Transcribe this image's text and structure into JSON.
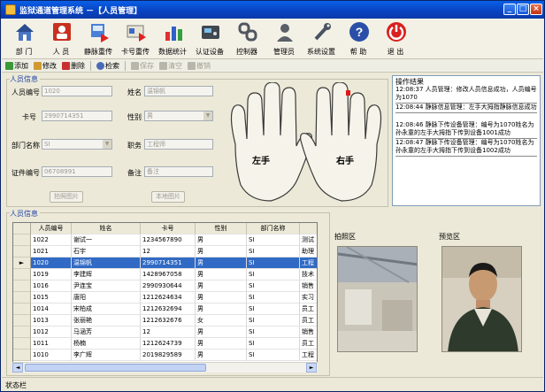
{
  "window": {
    "title": "监狱通道管理系统 －【人员管理】",
    "controls": {
      "minimize": "_",
      "restore": "□",
      "close": "×"
    }
  },
  "toolbar": [
    {
      "label": "部 门",
      "icon": "house-icon"
    },
    {
      "label": "人 员",
      "icon": "person-card-icon"
    },
    {
      "label": "静脉重传",
      "icon": "vein-upload-icon"
    },
    {
      "label": "卡号重传",
      "icon": "card-upload-icon"
    },
    {
      "label": "数据统计",
      "icon": "bar-chart-icon"
    },
    {
      "label": "认证设备",
      "icon": "device-icon"
    },
    {
      "label": "控制器",
      "icon": "chain-icon"
    },
    {
      "label": "管理员",
      "icon": "admin-icon"
    },
    {
      "label": "系统设置",
      "icon": "wrench-icon"
    },
    {
      "label": "帮 助",
      "icon": "help-icon"
    },
    {
      "label": "退 出",
      "icon": "power-icon"
    }
  ],
  "commands": {
    "add": "添加",
    "edit": "修改",
    "delete": "删除",
    "search": "检索",
    "save": "保存",
    "clear": "清空",
    "undo": "撤销"
  },
  "form": {
    "section_title": "人员信息",
    "id_label": "人员编号",
    "id_value": "1020",
    "name_label": "姓名",
    "name_value": "温锦帆",
    "card_label": "卡号",
    "card_value": "2990714351",
    "gender_label": "性别",
    "gender_value": "男",
    "dept_label": "部门名称",
    "dept_value": "SI",
    "job_label": "职务",
    "job_value": "工程师",
    "cert_label": "证件编号",
    "cert_value": "06708991",
    "note_label": "备注",
    "note_value": "备注",
    "capture_button": "拍照图片",
    "local_button": "本地图片"
  },
  "hands": {
    "left": "左手",
    "right": "右手"
  },
  "log": {
    "title": "操作结果",
    "entries": [
      "12:08:37  人员管理：修改人员信息成功，人员编号为1070",
      "12:08:44  静脉信息管理：左手大拇指静脉信息成功",
      "12:08:46  静脉下传设备管理：编号为1070姓名为孙永童的左手大拇指下传到设备1001成功",
      "12:08:47  静脉下传设备管理：编号为1070姓名为孙永童的左手大拇指下传到设备1002成功"
    ]
  },
  "grid": {
    "section_title": "人员信息",
    "columns": [
      "人员编号",
      "姓名",
      "卡号",
      "性别",
      "部门名称",
      ""
    ],
    "rows": [
      [
        "1022",
        "谢试一",
        "1234567890",
        "男",
        "SI",
        "测试"
      ],
      [
        "1021",
        "石宇",
        "12",
        "男",
        "SI",
        "助理"
      ],
      [
        "1020",
        "温锦帆",
        "2990714351",
        "男",
        "SI",
        "工程"
      ],
      [
        "1019",
        "李建辉",
        "1428967058",
        "男",
        "SI",
        "技术"
      ],
      [
        "1016",
        "尹连宝",
        "2990930644",
        "男",
        "SI",
        "销售"
      ],
      [
        "1015",
        "唐阳",
        "1212624634",
        "男",
        "SI",
        "实习"
      ],
      [
        "1014",
        "宋柏成",
        "1212632694",
        "男",
        "SI",
        "员工"
      ],
      [
        "1013",
        "张丽艳",
        "1212632676",
        "女",
        "SI",
        "员工"
      ],
      [
        "1012",
        "马涵芳",
        "12",
        "男",
        "SI",
        "销售"
      ],
      [
        "1011",
        "杨楠",
        "1212624739",
        "男",
        "SI",
        "员工"
      ],
      [
        "1010",
        "李广辉",
        "2019829589",
        "男",
        "SI",
        "工程"
      ]
    ],
    "selected_index": 2,
    "row_marker": "►",
    "scroll_left": "◄",
    "scroll_right": "►"
  },
  "photos": {
    "capture_label": "拍照区",
    "preview_label": "预览区"
  },
  "status": {
    "text": "状态栏"
  },
  "colors": {
    "title_bar": "#0842c0",
    "selected_row": "#316ac5",
    "section_title": "#1c3fa8",
    "red_marker": "#e01818"
  }
}
